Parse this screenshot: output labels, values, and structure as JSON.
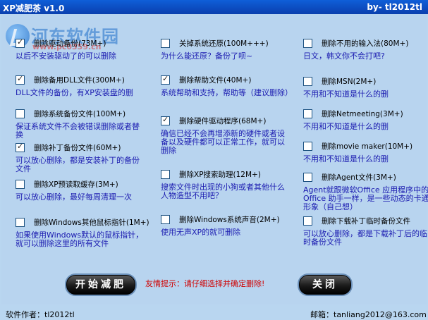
{
  "window": {
    "title": "XP减肥茶 v1.0",
    "author_tag": "by- tl2012tl"
  },
  "watermark": {
    "name": "河东软件园",
    "url": "www.pc0359.cn"
  },
  "columns": [
    [
      {
        "label": "删除驱动备份(73M+)",
        "checked": true,
        "desc": "以后不安装驱动了的可以删除"
      },
      {
        "label": "删除备用DLL文件(300M+)",
        "checked": true,
        "desc": "DLL文件的备份，有XP安装盘的删"
      },
      {
        "label": "删除系统备份文件(100M+)",
        "checked": false,
        "desc": "保证系统文件不会被错误删除或者替换"
      },
      {
        "label": "删除补丁备份文件(60M+)",
        "checked": true,
        "desc": "可以放心删除，都是安装补丁的备份文件"
      },
      {
        "label": "删除XP预读取缓存(3M+)",
        "checked": false,
        "desc": "可以放心删除，最好每周清理一次"
      },
      {
        "label": "删除Windows其他鼠标指针(1M+)",
        "checked": false,
        "desc": "如果使用Windows默认的鼠标指针，就可以删除这里的所有文件"
      }
    ],
    [
      {
        "label": "关掉系统还原(100M+++)",
        "checked": false,
        "desc": "为什么能还原？备份了呗~"
      },
      {
        "label": "删除帮助文件(40M+)",
        "checked": true,
        "desc": "系统帮助和支持，帮助等（建议删除）"
      },
      {
        "label": "删除硬件驱动程序(68M+)",
        "checked": true,
        "desc": "确信已经不会再增添新的硬件或者设备以及硬件都可以正常工作，就可以删除"
      },
      {
        "label": "删除XP搜索助理(12M+)",
        "checked": false,
        "desc": "搜索文件时出现的小狗或者其他什么人物造型不用吧？"
      },
      {
        "label": "删除Windows系统声音(2M+)",
        "checked": false,
        "desc": "使用无声XP的就可删除"
      }
    ],
    [
      {
        "label": "删除不用的输入法(80M+)",
        "checked": false,
        "desc": "日文，韩文你不会打吧?"
      },
      {
        "label": "删除MSN(2M+)",
        "checked": false,
        "desc": "不用和不知道是什么的删"
      },
      {
        "label": "删除Netmeeting(3M+)",
        "checked": false,
        "desc": "不用和不知道是什么的删"
      },
      {
        "label": "删除movie maker(10M+)",
        "checked": false,
        "desc": "不用和不知道是什么的删"
      },
      {
        "label": "删除Agent文件(3M+)",
        "checked": false,
        "desc": "Agent就跟微软Office 应用程序中的Office 助手一样，是一些动态的卡通形象（自己想）"
      },
      {
        "label": "删除下载补丁临时备份文件",
        "checked": false,
        "desc": "可以放心删除，都是下载补丁后的临时备份文件"
      }
    ]
  ],
  "buttons": {
    "start": "开始减肥",
    "close": "关闭"
  },
  "tip": "友情提示：请仔细选择并确定删除!",
  "footer": {
    "author": "软件作者：tl2012tl",
    "email": "邮箱：tanliang2012@163.com"
  }
}
